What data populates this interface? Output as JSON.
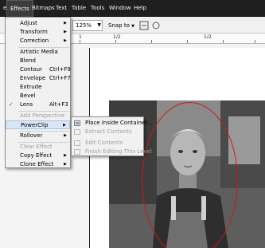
{
  "menubar": {
    "items": [
      {
        "label": "e"
      },
      {
        "label": "Effects"
      },
      {
        "label": "Bitmaps"
      },
      {
        "label": "Text"
      },
      {
        "label": "Table"
      },
      {
        "label": "Tools"
      },
      {
        "label": "Window"
      },
      {
        "label": "Help"
      }
    ]
  },
  "toolbar": {
    "zoom": "125%",
    "snap": "Snap to"
  },
  "ruler": {
    "labels": [
      "1",
      "1/2",
      "1/2"
    ]
  },
  "effects_menu": {
    "items": [
      {
        "label": "Adjust"
      },
      {
        "label": "Transform"
      },
      {
        "label": "Correction"
      },
      {
        "label": "Artistic Media"
      },
      {
        "label": "Blend"
      },
      {
        "label": "Contour",
        "shortcut": "Ctrl+F9"
      },
      {
        "label": "Envelope",
        "shortcut": "Ctrl+F7"
      },
      {
        "label": "Extrude"
      },
      {
        "label": "Bevel"
      },
      {
        "label": "Lens",
        "shortcut": "Alt+F3"
      },
      {
        "label": "Add Perspective"
      },
      {
        "label": "PowerClip"
      },
      {
        "label": "Rollover"
      },
      {
        "label": "Clear Effect"
      },
      {
        "label": "Copy Effect"
      },
      {
        "label": "Clone Effect"
      }
    ]
  },
  "powerclip_submenu": {
    "items": [
      {
        "label": "Place Inside Container..."
      },
      {
        "label": "Extract Contents"
      },
      {
        "label": "Edit Contents"
      },
      {
        "label": "Finish Editing This Level"
      }
    ]
  },
  "colors": {
    "menubar_bg": "#1f1f1f",
    "ellipse_outline": "#d01818",
    "hover_highlight": "#d9e6f6"
  }
}
